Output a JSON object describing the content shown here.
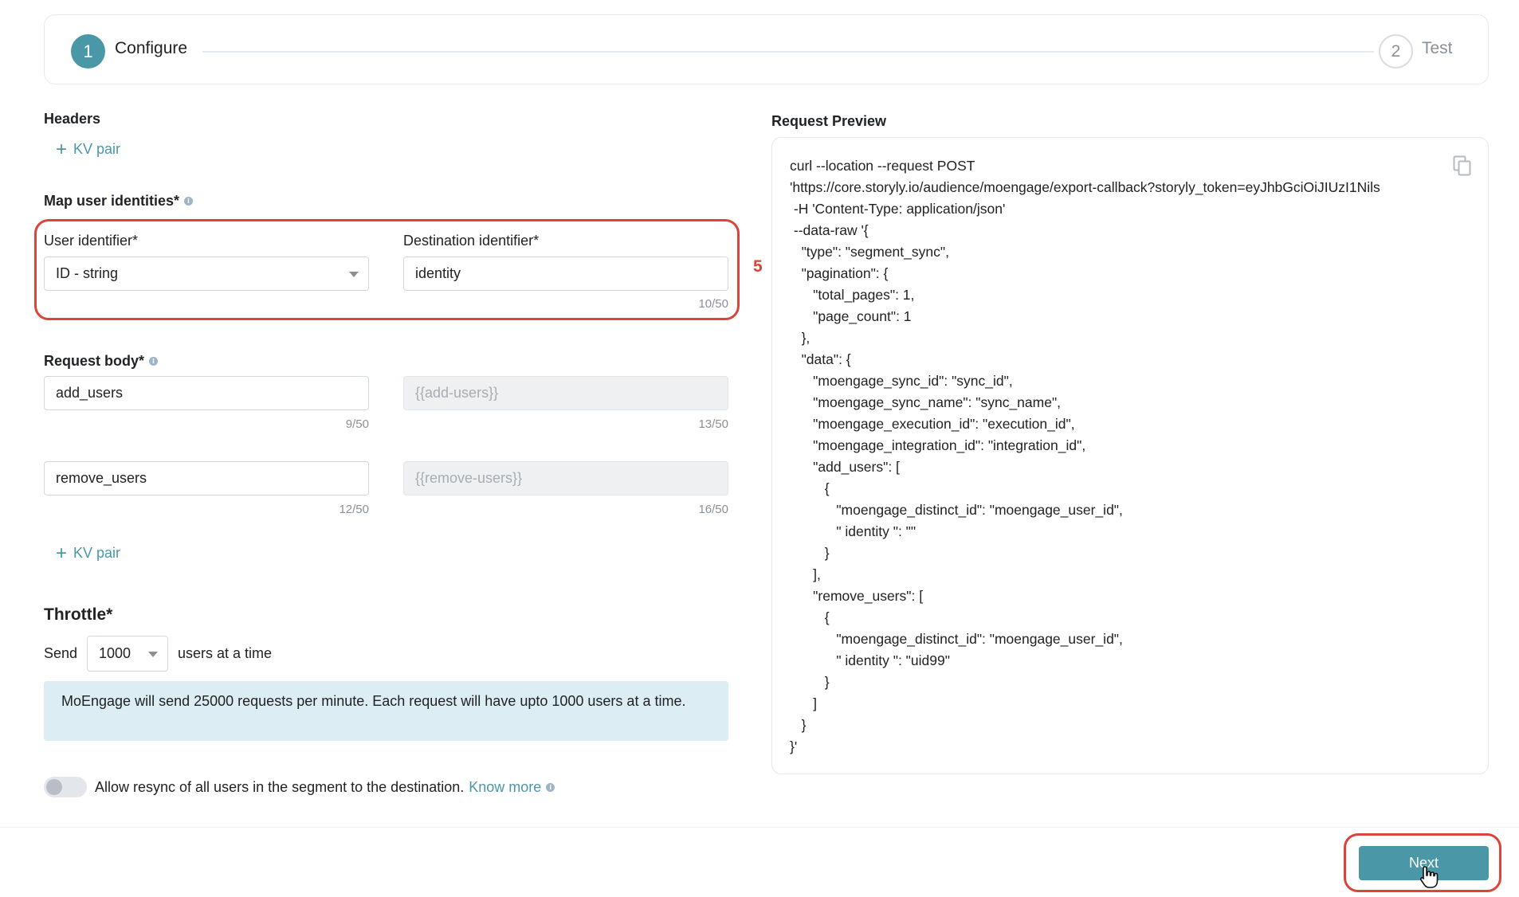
{
  "stepper": {
    "step1_number": "1",
    "step1_label": "Configure",
    "step2_number": "2",
    "step2_label": "Test"
  },
  "headers": {
    "title": "Headers",
    "add_kv_label": "KV pair"
  },
  "map_identities": {
    "title": "Map user identities*",
    "annotation_number": "5",
    "user_identifier_label": "User identifier*",
    "user_identifier_value": "ID - string",
    "destination_identifier_label": "Destination identifier*",
    "destination_identifier_value": "identity",
    "destination_counter": "10/50"
  },
  "request_body": {
    "title": "Request body*",
    "rows": [
      {
        "key": "add_users",
        "key_counter": "9/50",
        "value": "{{add-users}}",
        "value_counter": "13/50"
      },
      {
        "key": "remove_users",
        "key_counter": "12/50",
        "value": "{{remove-users}}",
        "value_counter": "16/50"
      }
    ],
    "add_kv_label": "KV pair"
  },
  "throttle": {
    "title": "Throttle*",
    "send_label": "Send",
    "batch_size": "1000",
    "suffix_label": "users at a time",
    "info_text": "MoEngage will send 25000 requests per minute. Each request will have upto 1000 users at a time."
  },
  "resync": {
    "enabled": false,
    "label": "Allow resync of all users in the segment to the destination.",
    "link_label": "Know more"
  },
  "preview": {
    "title": "Request Preview",
    "code": "curl --location --request POST\n'https://core.storyly.io/audience/moengage/export-callback?storyly_token=eyJhbGciOiJIUzI1Nils\n -H 'Content-Type: application/json'\n --data-raw '{\n   \"type\": \"segment_sync\",\n   \"pagination\": {\n      \"total_pages\": 1,\n      \"page_count\": 1\n   },\n   \"data\": {\n      \"moengage_sync_id\": \"sync_id\",\n      \"moengage_sync_name\": \"sync_name\",\n      \"moengage_execution_id\": \"execution_id\",\n      \"moengage_integration_id\": \"integration_id\",\n      \"add_users\": [\n         {\n            \"moengage_distinct_id\": \"moengage_user_id\",\n            \" identity \": \"\"\n         }\n      ],\n      \"remove_users\": [\n         {\n            \"moengage_distinct_id\": \"moengage_user_id\",\n            \" identity \": \"uid99\"\n         }\n      ]\n   }\n}'"
  },
  "footer": {
    "next_label": "Next"
  },
  "colors": {
    "accent": "#4a97a8",
    "highlight": "#d9453a",
    "info_bg": "#dcedf4"
  },
  "icons": [
    "plus-icon",
    "info-icon",
    "chevron-down-icon",
    "copy-icon",
    "hand-cursor-icon"
  ]
}
